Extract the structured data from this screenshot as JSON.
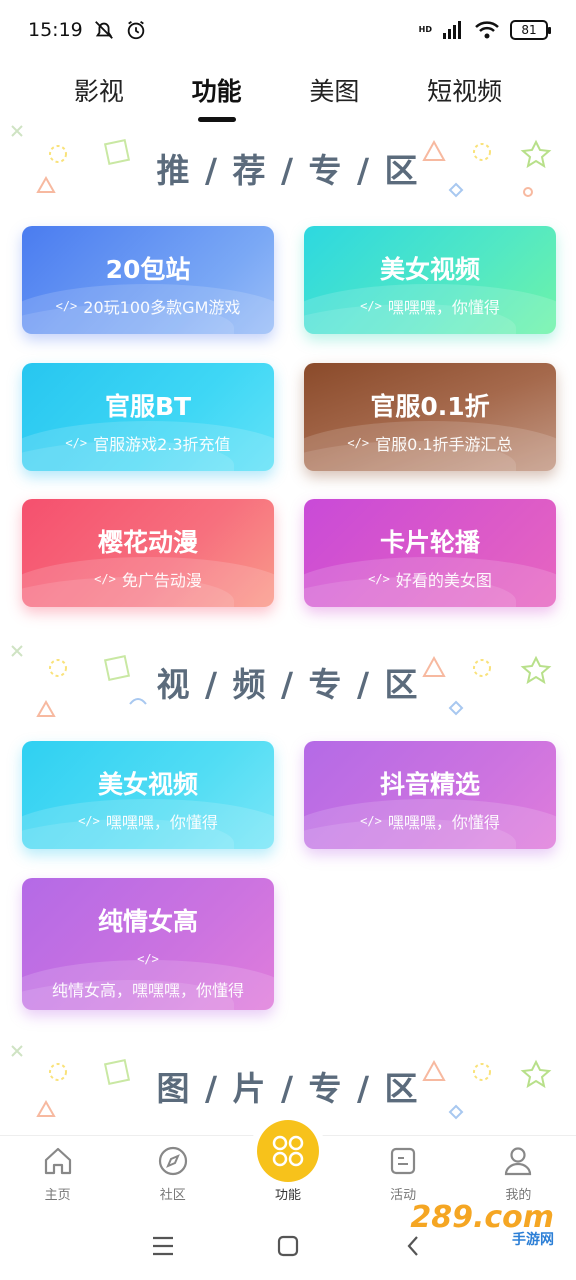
{
  "status_bar": {
    "time": "15:19",
    "network_label": "HD",
    "battery": "81"
  },
  "top_tabs": [
    {
      "label": "影视",
      "active": false
    },
    {
      "label": "功能",
      "active": true
    },
    {
      "label": "美图",
      "active": false
    },
    {
      "label": "短视频",
      "active": false
    }
  ],
  "sections": {
    "recommend": {
      "title": "推 / 荐 / 专 / 区"
    },
    "video": {
      "title": "视 / 频 / 专 / 区"
    },
    "picture": {
      "title": "图 / 片 / 专 / 区"
    }
  },
  "recommend_cards": [
    {
      "title": "20包站",
      "subtitle": "20玩100多款GM游戏"
    },
    {
      "title": "美女视频",
      "subtitle": "嘿嘿嘿，你懂得"
    },
    {
      "title": "官服BT",
      "subtitle": "官服游戏2.3折充值"
    },
    {
      "title": "官服0.1折",
      "subtitle": "官服0.1折手游汇总"
    },
    {
      "title": "樱花动漫",
      "subtitle": "免广告动漫"
    },
    {
      "title": "卡片轮播",
      "subtitle": "好看的美女图"
    }
  ],
  "video_cards": [
    {
      "title": "美女视频",
      "subtitle": "嘿嘿嘿，你懂得"
    },
    {
      "title": "抖音精选",
      "subtitle": "嘿嘿嘿，你懂得"
    },
    {
      "title": "纯情女高",
      "subtitle": "纯情女高，嘿嘿嘿，你懂得"
    }
  ],
  "code_icon": "</>",
  "bottom_nav": [
    {
      "label": "主页",
      "icon": "home-icon"
    },
    {
      "label": "社区",
      "icon": "compass-icon"
    },
    {
      "label": "功能",
      "icon": "grid-icon",
      "active": true
    },
    {
      "label": "活动",
      "icon": "activity-icon"
    },
    {
      "label": "我的",
      "icon": "user-icon"
    }
  ],
  "watermark": {
    "brand": "289.com",
    "sub": "手游网"
  },
  "colors": {
    "accent_yellow": "#f7c21b",
    "section_title": "#5b6b7c"
  }
}
